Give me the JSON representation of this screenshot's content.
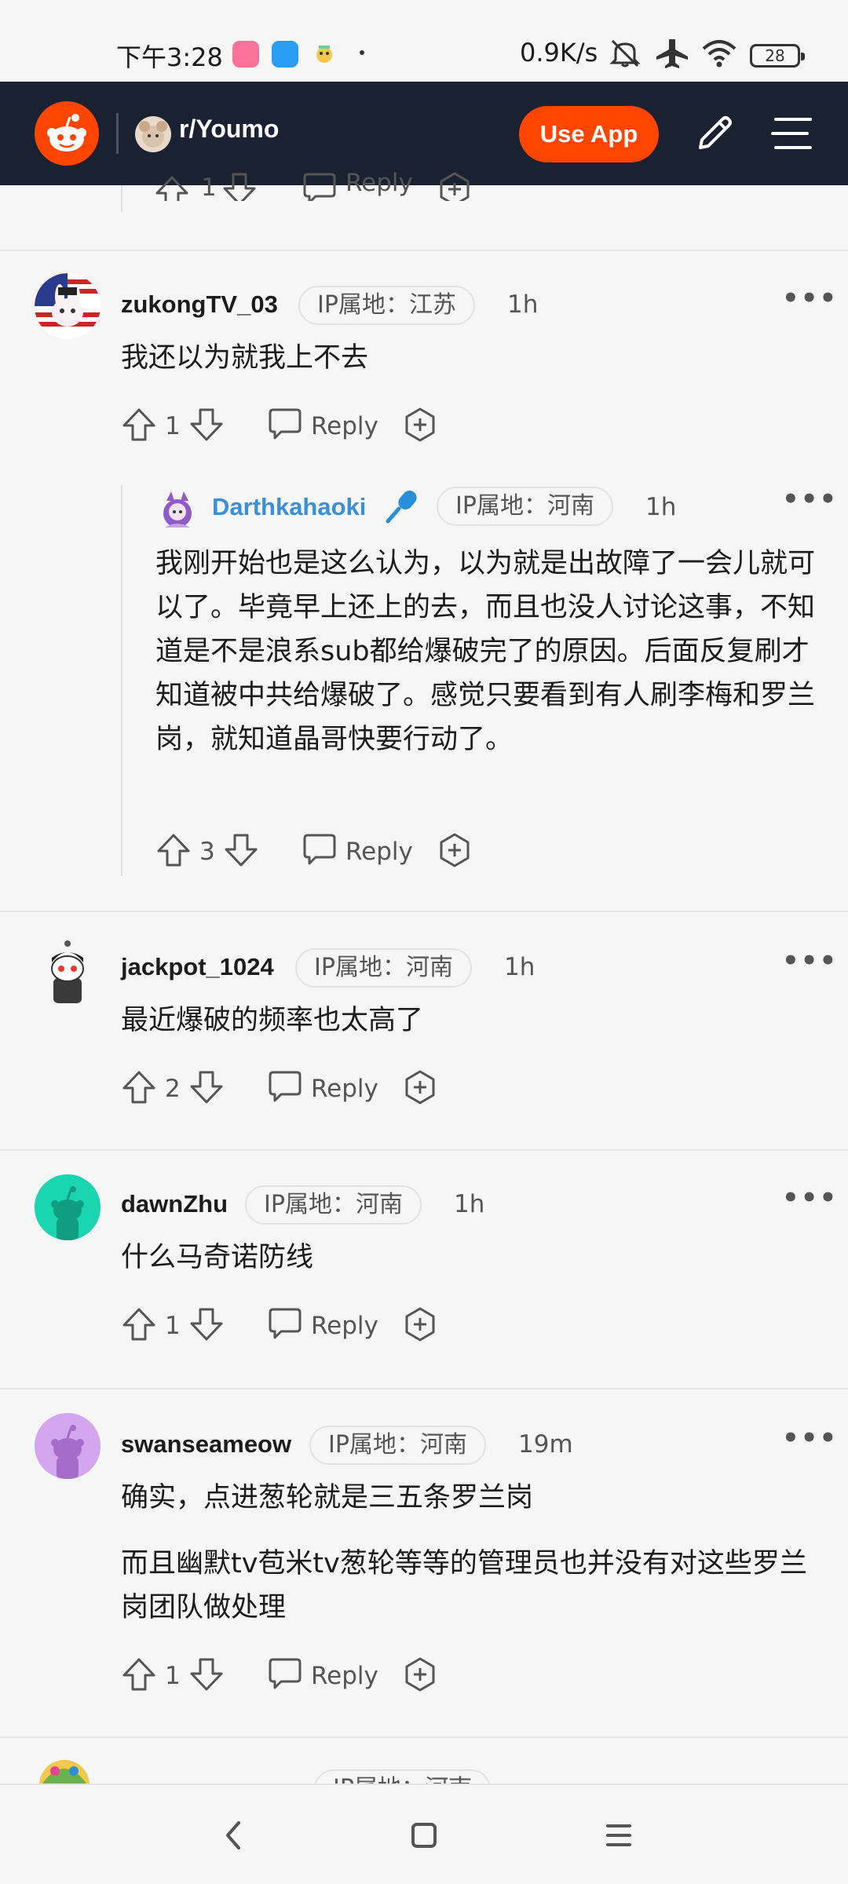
{
  "status_bar": {
    "time": "下午3:28",
    "net_speed": "0.9K/s",
    "battery": "28"
  },
  "header": {
    "subreddit": "r/Youmo",
    "use_app_label": "Use App"
  },
  "top_partial": {
    "votes": "1",
    "reply_label": "Reply"
  },
  "comments": [
    {
      "username": "zukongTV_03",
      "ip": "IP属地：江苏",
      "time": "1h",
      "text": "我还以为就我上不去",
      "votes": "1",
      "reply_label": "Reply"
    },
    {
      "username": "Darthkahaoki",
      "ip": "IP属地：河南",
      "time": "1h",
      "text": "我刚开始也是这么认为，以为就是出故障了一会儿就可以了。毕竟早上还上的去，而且也没人讨论这事，不知道是不是浪系sub都给爆破完了的原因。后面反复刷才知道被中共给爆破了。感觉只要看到有人刷李梅和罗兰岗，就知道晶哥快要行动了。",
      "votes": "3",
      "reply_label": "Reply"
    },
    {
      "username": "jackpot_1024",
      "ip": "IP属地：河南",
      "time": "1h",
      "text": "最近爆破的频率也太高了",
      "votes": "2",
      "reply_label": "Reply"
    },
    {
      "username": "dawnZhu",
      "ip": "IP属地：河南",
      "time": "1h",
      "text": "什么马奇诺防线",
      "votes": "1",
      "reply_label": "Reply"
    },
    {
      "username": "swanseameow",
      "ip": "IP属地：河南",
      "time": "19m",
      "text": "确实，点进葱轮就是三五条罗兰岗",
      "text2": "而且幽默tv苞米tv葱轮等等的管理员也并没有对这些罗兰岗团队做处理",
      "votes": "1",
      "reply_label": "Reply"
    }
  ],
  "partial_next": {
    "ip": "IP属地：河南"
  },
  "colors": {
    "header_bg": "#1a2130",
    "accent": "#ff4500",
    "username_blue": "#3b8fd6"
  }
}
